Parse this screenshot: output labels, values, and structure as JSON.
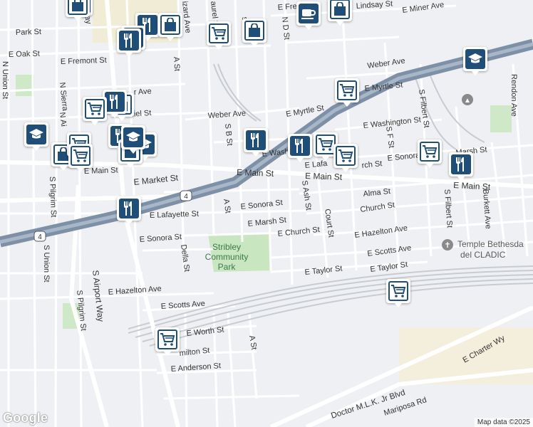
{
  "attribution": "Map data ©2025",
  "logo": "Google",
  "park": {
    "line1": "Stribley",
    "line2": "Community",
    "line3": "Park"
  },
  "poi": {
    "temple_line1": "Temple Bethesda",
    "temple_line2": "del CLADIC"
  },
  "highway_shield": "4",
  "streets": {
    "e_fremont_st_top": "E Frem",
    "e_lindsay_st": "Lindsay St",
    "e_miner_ave": "E Miner Ave",
    "park_st": "Park St",
    "e_oak_st": "E Oak St",
    "e_fremont_st": "E Fremont St",
    "n_union_st": "N Union St",
    "n_sierra": "N Sierra",
    "n_way": "n Way",
    "e_weber_ave_w": "r Ave",
    "weber_ave": "Weber Ave",
    "weber_ave_e": "Weber Ave",
    "e_myrtle_st": "E Myrtle St",
    "e_myrtle_st_e": "E Myrtle St",
    "e_washington_st": "E Washington St",
    "e_washing": "E Washing",
    "s_b_st": "S B St",
    "a_st_top": "A St",
    "n_d_st": "N D St",
    "s_ave": "s Ave",
    "zard_ave": "izard Ave",
    "laurel_st": "aurel St",
    "niel_st": "niel St",
    "n_ai": "N Ai",
    "e_main_st_w": "E Main St",
    "e_market_st": "E Market St",
    "e_main_st": "E Main St",
    "e_main_st_mid": "E Main St",
    "e_main_st_e": "E Main St",
    "e_sonora_st": "E Sonora St",
    "e_sonora_st_e": "E Sonora St",
    "e_sonora_st_w": "E Sonora St",
    "e_lafayette_st": "E Lafayette St",
    "e_lafa": "E Lafa",
    "e_marsh_st": "E Marsh St",
    "e_marsh_st_e": "Marsh St",
    "e_church_st": "E Church St",
    "church_st": "Church St",
    "alma_st": "Alma St",
    "e_hazelton_ave": "E Hazelton Ave",
    "e_hazelton_ave_w": "E Hazelton Ave",
    "e_scotts_ave": "E Scotts Ave",
    "e_scotts_ave_w": "E Scotts Ave",
    "e_taylor_st": "E Taylor St",
    "e_taylor_st_w": "E Taylor St",
    "e_worth_st": "E Worth St",
    "e_anderson_st": "E Anderson St",
    "hamilton_st": "milton St",
    "a_st": "A St",
    "a_st_south": "A St",
    "s_ash_st": "S Ash St",
    "court_st": "Court St",
    "s_f_st": "S F St",
    "s_filbert_st": "S Filbert St",
    "s_filbert_st_top": "S Filbert St",
    "burkett_ave": "Burkett Ave",
    "rendon_ave": "Rendon Ave",
    "della_st": "Della St",
    "s_pilgrim_st": "S Pilgrim St",
    "s_pilgrim_st_s": "S Pilgrim St",
    "s_union_st": "S Union St",
    "s_airport_way": "S Airport Way",
    "e_charter_wy": "E Charter Wy",
    "mlk_blvd": "Doctor M.L.K. Jr Blvd",
    "mariposa_rd": "Mariposa Rd",
    "rch_st": "rch St",
    "st_e": "St"
  },
  "pins": [
    {
      "type": "shopping-cart"
    },
    {
      "type": "shopping-bag"
    },
    {
      "type": "restaurant"
    },
    {
      "type": "cafe"
    },
    {
      "type": "shopping-bag"
    },
    {
      "type": "restaurant"
    },
    {
      "type": "cafe"
    },
    {
      "type": "shopping-bag"
    },
    {
      "type": "shopping-cart"
    },
    {
      "type": "shopping-bag"
    },
    {
      "type": "school"
    },
    {
      "type": "shopping-cart"
    },
    {
      "type": "shopping-bag"
    },
    {
      "type": "restaurant"
    },
    {
      "type": "school"
    },
    {
      "type": "shopping-bag"
    },
    {
      "type": "shopping-cart"
    },
    {
      "type": "restaurant"
    },
    {
      "type": "shopping-cart"
    },
    {
      "type": "school"
    },
    {
      "type": "shopping-bag"
    },
    {
      "type": "shopping-cart"
    },
    {
      "type": "restaurant"
    },
    {
      "type": "restaurant"
    },
    {
      "type": "shopping-cart"
    },
    {
      "type": "shopping-cart"
    },
    {
      "type": "shopping-cart"
    },
    {
      "type": "restaurant"
    },
    {
      "type": "shopping-cart"
    },
    {
      "type": "shopping-cart"
    },
    {
      "type": "restaurant"
    },
    {
      "type": "school"
    }
  ]
}
